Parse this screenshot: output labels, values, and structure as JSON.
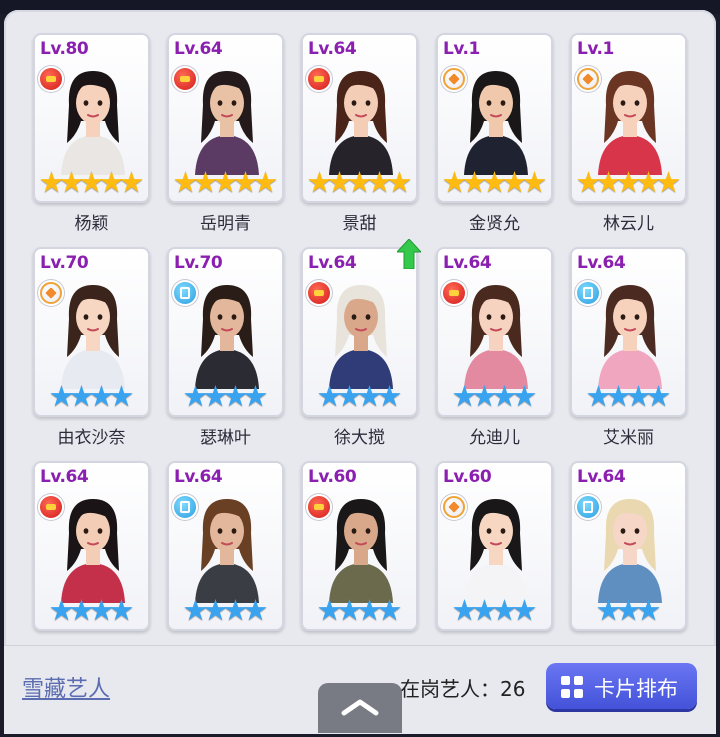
{
  "cards": [
    {
      "level": "Lv.80",
      "badge": "red",
      "stars": 5,
      "star_color": "gold",
      "name": "杨颖",
      "hair": "#1b1416",
      "skin": "#f6d2bd",
      "outfit": "#e9e6e3"
    },
    {
      "level": "Lv.64",
      "badge": "red",
      "stars": 5,
      "star_color": "gold",
      "name": "岳明青",
      "hair": "#241a1c",
      "skin": "#e9c2a6",
      "outfit": "#5b3b63"
    },
    {
      "level": "Lv.64",
      "badge": "red",
      "stars": 5,
      "star_color": "gold",
      "name": "景甜",
      "hair": "#4a2418",
      "skin": "#f4cdb6",
      "outfit": "#26232a"
    },
    {
      "level": "Lv.1",
      "badge": "orange",
      "stars": 5,
      "star_color": "gold",
      "name": "金贤允",
      "hair": "#1a1718",
      "skin": "#f0c9ad",
      "outfit": "#1f2230"
    },
    {
      "level": "Lv.1",
      "badge": "orange",
      "stars": 5,
      "star_color": "gold",
      "name": "林云儿",
      "hair": "#6a3522",
      "skin": "#f6d1bc",
      "outfit": "#d8354a"
    },
    {
      "level": "Lv.70",
      "badge": "orange",
      "stars": 4,
      "star_color": "blue",
      "name": "由衣沙奈",
      "hair": "#3a241c",
      "skin": "#f7d6c2",
      "outfit": "#e8eaf2"
    },
    {
      "level": "Lv.70",
      "badge": "blue",
      "stars": 4,
      "star_color": "blue",
      "name": "瑟琳叶",
      "hair": "#2a1c16",
      "skin": "#e2b79b",
      "outfit": "#2b2b33"
    },
    {
      "level": "Lv.64",
      "badge": "red",
      "stars": 4,
      "star_color": "blue",
      "name": "徐大搅",
      "hair": "#e8e4dc",
      "skin": "#d9a88a",
      "outfit": "#2f3c78"
    },
    {
      "level": "Lv.64",
      "badge": "red",
      "stars": 4,
      "star_color": "blue",
      "name": "允迪儿",
      "hair": "#4a2a1e",
      "skin": "#f6d2c0",
      "outfit": "#e38aa0"
    },
    {
      "level": "Lv.64",
      "badge": "blue",
      "stars": 4,
      "star_color": "blue",
      "name": "艾米丽",
      "hair": "#4b2a22",
      "skin": "#f6d2bd",
      "outfit": "#f1a6c0"
    },
    {
      "level": "Lv.64",
      "badge": "red",
      "stars": 4,
      "star_color": "blue",
      "name": "",
      "hair": "#1b1416",
      "skin": "#f4cdb6",
      "outfit": "#c4304a"
    },
    {
      "level": "Lv.64",
      "badge": "blue",
      "stars": 4,
      "star_color": "blue",
      "name": "",
      "hair": "#6a4025",
      "skin": "#e2b79b",
      "outfit": "#3b3d44"
    },
    {
      "level": "Lv.60",
      "badge": "red",
      "stars": 4,
      "star_color": "blue",
      "name": "",
      "hair": "#1a1718",
      "skin": "#d9a88a",
      "outfit": "#6b6a4c"
    },
    {
      "level": "Lv.60",
      "badge": "orange",
      "stars": 4,
      "star_color": "blue",
      "name": "",
      "hair": "#1a1718",
      "skin": "#f7d6c2",
      "outfit": "#f4f4f6"
    },
    {
      "level": "Lv.64",
      "badge": "blue",
      "stars": 3,
      "star_color": "blue",
      "name": "",
      "hair": "#ead9b0",
      "skin": "#f6d6c6",
      "outfit": "#5f8fc0"
    }
  ],
  "footer": {
    "storage_link": "雪藏艺人",
    "active_count_label": "在岗艺人：26",
    "layout_button_label": "卡片排布"
  },
  "icons": {
    "upgrade": "green-up-arrow-icon",
    "collapse": "chevron-up-icon",
    "layout": "grid-icon"
  },
  "colors": {
    "level_text": "#8a1fb0",
    "button": "#4f5de2",
    "upgrade_arrow": "#34c94a"
  }
}
